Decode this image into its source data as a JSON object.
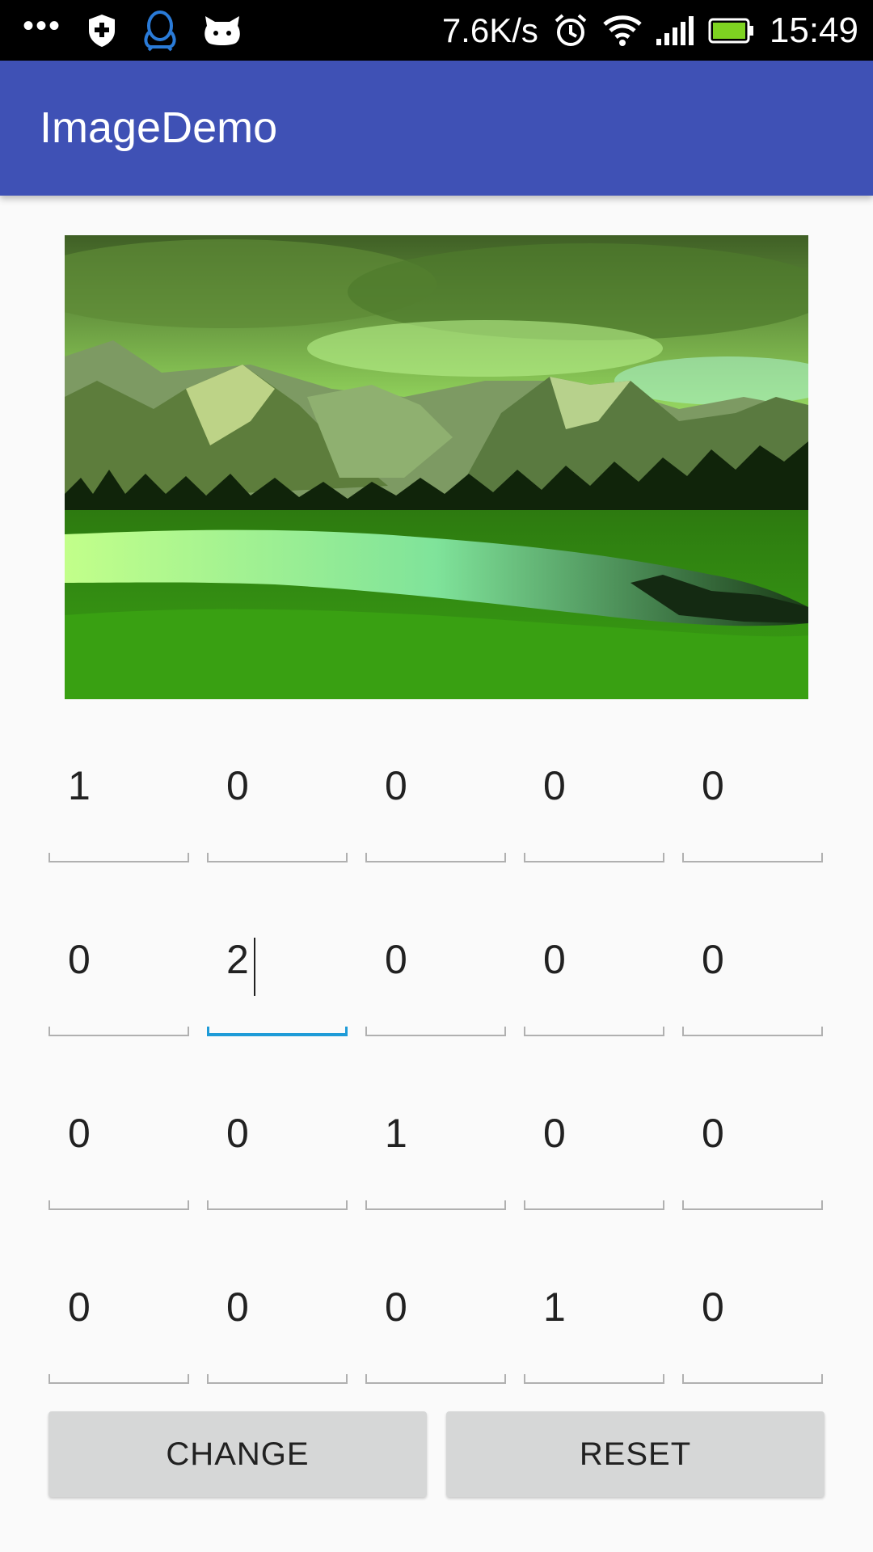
{
  "status_bar": {
    "dots": "•••",
    "speed": "7.6K/s",
    "time": "15:49",
    "icons": [
      "shield-plus-icon",
      "penguin-icon",
      "cat-icon",
      "alarm-icon",
      "wifi-icon",
      "signal-icon",
      "battery-icon"
    ],
    "battery_level": 1.0
  },
  "app_bar": {
    "title": "ImageDemo",
    "color": "#3f51b5"
  },
  "image": {
    "subject": "landscape-image"
  },
  "matrix": {
    "rows": [
      [
        "1",
        "0",
        "0",
        "0",
        "0"
      ],
      [
        "0",
        "2",
        "0",
        "0",
        "0"
      ],
      [
        "0",
        "0",
        "1",
        "0",
        "0"
      ],
      [
        "0",
        "0",
        "0",
        "1",
        "0"
      ]
    ],
    "focused_row": 1,
    "focused_col": 1,
    "focus_color": "#1e9bd7"
  },
  "buttons": {
    "change_label": "CHANGE",
    "reset_label": "RESET"
  }
}
